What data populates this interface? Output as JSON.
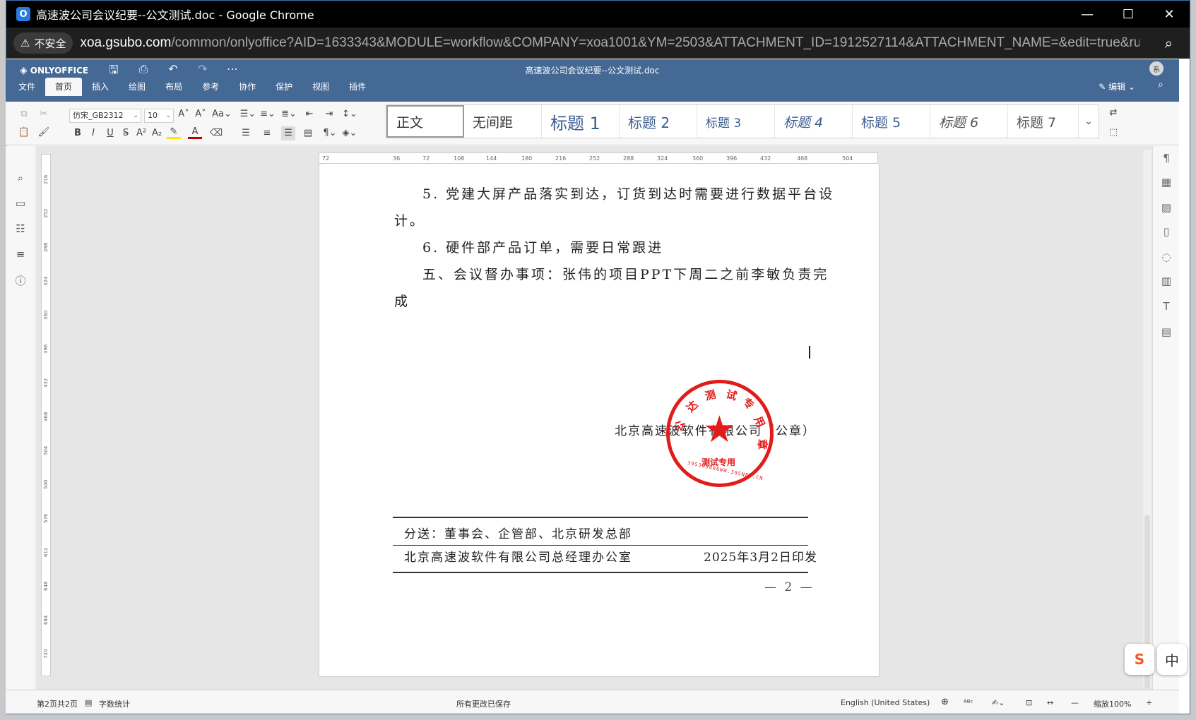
{
  "browser": {
    "window_title": "高速波公司会议纪要--公文测试.doc - Google Chrome",
    "app_icon": "O",
    "insecure_label": "不安全",
    "url_host": "xoa.gsubo.com",
    "url_path": "/common/onlyoffice?AID=1633343&MODULE=workflow&COMPANY=xoa1001&YM=2503&ATTACHMENT_ID=1912527114&ATTACHMENT_NAME=&edit=true&ru...",
    "minimize": "—",
    "maximize": "☐",
    "close": "✕"
  },
  "editor": {
    "brand": "ONLYOFFICE",
    "doc_title": "高速波公司会议纪要--公文测试.doc",
    "avatar": "系",
    "edit_mode": "编辑",
    "tabs": [
      "文件",
      "首页",
      "插入",
      "绘图",
      "布局",
      "参考",
      "协作",
      "保护",
      "视图",
      "插件"
    ],
    "active_tab": "首页"
  },
  "toolbar": {
    "font": "仿宋_GB2312",
    "size": "10",
    "styles": [
      "正文",
      "无间距",
      "标题 1",
      "标题 2",
      "标题 3",
      "标题 4",
      "标题 5",
      "标题 6",
      "标题 7"
    ]
  },
  "ruler": {
    "h_ticks": [
      "72",
      "36",
      "72",
      "108",
      "144",
      "180",
      "216",
      "252",
      "288",
      "324",
      "360",
      "396",
      "432",
      "468",
      "504"
    ],
    "v_ticks": [
      "216",
      "252",
      "288",
      "324",
      "360",
      "396",
      "432",
      "468",
      "504",
      "540",
      "576",
      "612",
      "648",
      "684",
      "720"
    ]
  },
  "document": {
    "line1": "5. 党建大屏产品落实到达，订货到达时需要进行数据平台设",
    "line2": "计。",
    "line3": "6. 硬件部产品订单，需要日常跟进",
    "line4": "五、会议督办事项：张伟的项目PPT下周二之前李敏负责完",
    "line5": "成",
    "signature": "北京高速波软件有限公司（公章）",
    "cc": "分送：董事会、企管部、北京研发总部",
    "issuer": "北京高速波软件有限公司总经理办公室",
    "issue_date": "2025年3月2日印发",
    "page_number": "— 2 —"
  },
  "seal": {
    "arc_chars": [
      "达",
      "测",
      "试",
      "专",
      "用",
      "章",
      "公"
    ],
    "center": "测试专用",
    "number": "395395886WW.395NET.CN",
    "color": "#e21b1b"
  },
  "status": {
    "page_info": "第2页共2页",
    "word_count": "字数统计",
    "save_status": "所有更改已保存",
    "language": "English (United States)",
    "zoom": "缩放100%"
  },
  "ime": {
    "sogou": "S",
    "chinese": "中"
  }
}
